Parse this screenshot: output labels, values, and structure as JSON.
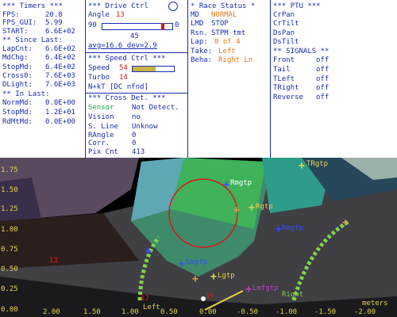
{
  "timers": {
    "header": "*** Timers ***",
    "fps_label": "FPS:",
    "fps": "20.8",
    "fps_gui_label": "FPS_GUI:",
    "fps_gui": "5.99",
    "start_label": "START:",
    "start": "6.6E+02",
    "since_header": "** Since Last:",
    "since": [
      {
        "label": "LapCnt:",
        "value": "6.6E+02"
      },
      {
        "label": "MdChg:",
        "value": "6.4E+02"
      },
      {
        "label": "StopMd:",
        "value": "6.4E+02"
      },
      {
        "label": "Cross0:",
        "value": "7.6E+03"
      },
      {
        "label": "DLight:",
        "value": "7.6E+03"
      }
    ],
    "in_header": "** In Last:",
    "in_last": [
      {
        "label": "NormMd:",
        "value": "0.0E+00"
      },
      {
        "label": "StopMd:",
        "value": "1.2E+01"
      },
      {
        "label": "RdMtMd:",
        "value": "0.0E+00"
      }
    ]
  },
  "drive": {
    "header": "*** Drive Ctrl",
    "angle_label": "Angle",
    "angle": "13",
    "scale_left": "90",
    "scale_right": "0",
    "scale_center": "45",
    "angle_fraction": 0.86,
    "avg": "avg=16.6",
    "dev": "dev=2.9",
    "speed_header": "*** Speed Ctrl ***",
    "speed_label": "Speed",
    "speed": "54",
    "speed_fraction": 0.55,
    "turbo_label": "Turbo",
    "turbo": "14",
    "nkt": "N+kT [DC nfnd]",
    "cross_header": "*** Cross Det. ***",
    "cross": [
      {
        "label": "Sensor",
        "value": "Not Detect."
      },
      {
        "label": "Vision",
        "value": "no"
      },
      {
        "label": "S. Line",
        "value": "Unknow"
      },
      {
        "label": "RAngle",
        "value": "0"
      },
      {
        "label": "Corr.",
        "value": "0"
      },
      {
        "label": "Pix Cnt",
        "value": "413"
      }
    ]
  },
  "race": {
    "header": "* Race Status *",
    "md_label": "MD",
    "md": "NORMAL",
    "lmd_label": "LMD",
    "lmd": "STOP",
    "rsn_label": "Rsn.",
    "rsn": "STPM tmt",
    "lap_label": "Lap:",
    "lap": "0 of 4",
    "take_label": "Take:",
    "take": "Left",
    "beha_label": "Beha:",
    "beha": "Right Ln"
  },
  "ptu": {
    "header": "*** PTU ***",
    "items": [
      "CrPan",
      "CrTilt",
      "DsPan",
      "DsTilt"
    ],
    "signals_header": "** SIGNALS **",
    "signals": [
      {
        "label": "Front",
        "value": "off"
      },
      {
        "label": "Tail",
        "value": "off"
      },
      {
        "label": "TLeft",
        "value": "off"
      },
      {
        "label": "TRight",
        "value": "off"
      },
      {
        "label": "Reverse",
        "value": "off"
      }
    ]
  },
  "camera": {
    "y_ticks": [
      "1.75",
      "1.50",
      "1.25",
      "1.00",
      "0.75",
      "0.50",
      "0.25",
      "0.00"
    ],
    "x_ticks": [
      "2.00",
      "1.50",
      "1.00",
      "0.50",
      "0.00",
      "-0.50",
      "-1.00",
      "-1.50",
      "-2.00"
    ],
    "units": "meters",
    "targets": {
      "rmgtp": "Rmgtp",
      "rgtp": "Rgtp",
      "trgtp": "TRgtp",
      "lmgtp": "Lmgtp",
      "lgtp": "Lgtp",
      "l_mfgtp": "Lmfgtp",
      "rmgtp2": "Rmgtp"
    },
    "left_label": "Left",
    "right_label": "Right",
    "mark_13": "13",
    "mark_17": "17",
    "mark_19": "19"
  }
}
